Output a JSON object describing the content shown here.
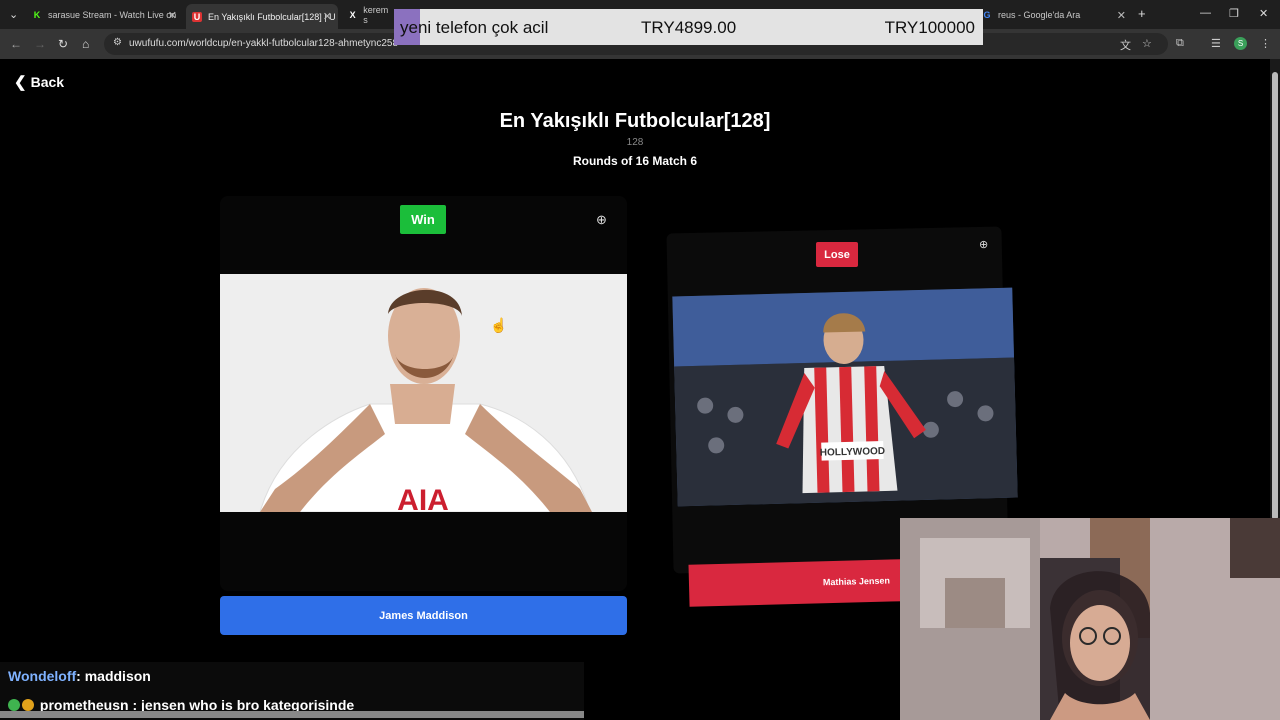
{
  "browser": {
    "tabs": [
      {
        "label": "sarasue Stream - Watch Live on",
        "icon": "kick-icon"
      },
      {
        "label": "En Yakışıklı Futbolcular[128] | U",
        "icon": "uwufufu-icon"
      },
      {
        "label": "kerem s",
        "icon": "x-icon"
      },
      {
        "label": "reus - Google'da Ara",
        "icon": "google-icon"
      }
    ],
    "url": "uwufufu.com/worldcup/en-yakkl-futbolcular128-ahmetync258",
    "profile_initial": "S"
  },
  "donation": {
    "message": "yeni telefon çok acil",
    "amount": "TRY4899.00",
    "goal": "TRY100000"
  },
  "page": {
    "back_label": "Back",
    "title": "En Yakışıklı Futbolcular[128]",
    "count": "128",
    "round": "Rounds of 16 Match 6",
    "left": {
      "badge": "Win",
      "name": "James Maddison"
    },
    "right": {
      "badge": "Lose",
      "name": "Mathias Jensen"
    }
  },
  "chat": [
    {
      "user": "Wondeloff",
      "message": ": maddison"
    },
    {
      "user": "prometheusn",
      "message": " : jensen who is bro kategorisinde"
    }
  ],
  "colors": {
    "win": "#1bbe3a",
    "lose": "#d9283f",
    "primary": "#2f6fe8"
  }
}
